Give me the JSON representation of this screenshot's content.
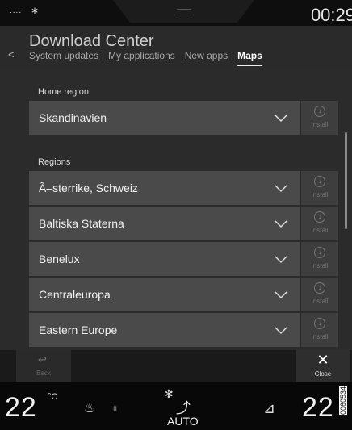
{
  "status": {
    "signal": "....",
    "bluetooth_icon": "bluetooth-icon",
    "clock": "00:29"
  },
  "header": {
    "title": "Download Center",
    "tabs": [
      {
        "label": "System updates",
        "active": false
      },
      {
        "label": "My applications",
        "active": false
      },
      {
        "label": "New apps",
        "active": false
      },
      {
        "label": "Maps",
        "active": true
      }
    ]
  },
  "home_region": {
    "label": "Home region",
    "value": "Skandinavien",
    "install_label": "Install"
  },
  "regions": {
    "label": "Regions",
    "items": [
      {
        "name": "Ã–sterrike, Schweiz",
        "install_label": "Install"
      },
      {
        "name": "Baltiska Staterna",
        "install_label": "Install"
      },
      {
        "name": "Benelux",
        "install_label": "Install"
      },
      {
        "name": "Centraleuropa",
        "install_label": "Install"
      },
      {
        "name": "Eastern Europe",
        "install_label": "Install"
      }
    ]
  },
  "actions": {
    "back_label": "Back",
    "close_label": "Close"
  },
  "climate": {
    "left_temp": "22",
    "unit": "°C",
    "seat_heat_level": "II",
    "mode": "AUTO",
    "right_temp": "22"
  },
  "image_id": "0060534",
  "colors": {
    "row_bg": "#4a4a4a",
    "content_bg": "#2b2b2b",
    "header_bg": "#2a2a2a",
    "climate_bg": "#080808"
  }
}
